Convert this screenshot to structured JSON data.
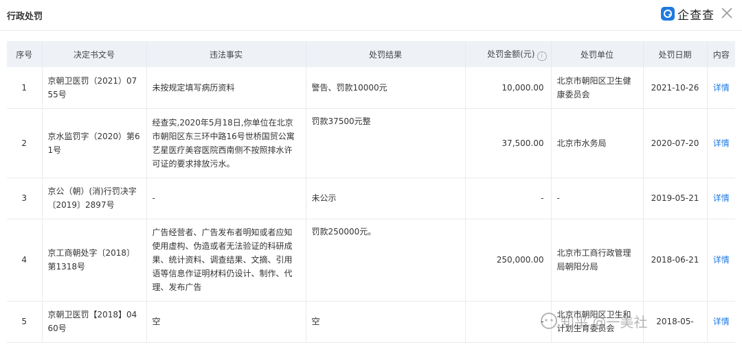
{
  "header": {
    "title": "行政处罚",
    "brand_name": "企查查"
  },
  "table": {
    "columns": [
      "序号",
      "决定书文号",
      "违法事实",
      "处罚结果",
      "处罚金额(元)",
      "处罚单位",
      "处罚日期",
      "内容"
    ],
    "rows": [
      {
        "seq": "1",
        "doc_no": "京朝卫医罚（2021）0755号",
        "facts": "未按规定填写病历资料",
        "result": "警告、罚款10000元",
        "amount": "10,000.00",
        "authority": "北京市朝阳区卫生健康委员会",
        "date": "2021-10-26",
        "action": "详情"
      },
      {
        "seq": "2",
        "doc_no": "京水监罚字（2020）第61号",
        "facts": "经查实,2020年5月18日,你单位在北京市朝阳区东三环中路16号世桥国贸公寓艺星医疗美容医院西南侧不按照排水许可证的要求排放污水。",
        "result": "罚款37500元整",
        "amount": "37,500.00",
        "authority": "北京市水务局",
        "date": "2020-07-20",
        "action": "详情"
      },
      {
        "seq": "3",
        "doc_no": "京公（朝）(消)行罚决字〔2019〕2897号",
        "facts": "-",
        "result": "未公示",
        "amount": "-",
        "authority": "-",
        "date": "2019-05-21",
        "action": "详情"
      },
      {
        "seq": "4",
        "doc_no": "京工商朝处字〔2018〕第1318号",
        "facts": "广告经营者、广告发布者明知或者应知使用虚构、伪造或者无法验证的科研成果、统计资料、调查结果、文摘、引用语等信息作证明材料仍设计、制作、代理、发布广告",
        "result": "罚款250000元。",
        "amount": "250,000.00",
        "authority": "北京市工商行政管理局朝阳分局",
        "date": "2018-06-21",
        "action": "详情"
      },
      {
        "seq": "5",
        "doc_no": "京朝卫医罚【2018】0460号",
        "facts": "空",
        "result": "空",
        "amount": "-",
        "authority": "北京市朝阳区卫生和计划生育委员会",
        "date": "2018-05-",
        "action": "详情"
      }
    ]
  },
  "watermark": {
    "text": "知乎 @一美社"
  },
  "colors": {
    "accent": "#1f7ae0",
    "header_bg": "#eef2f7"
  }
}
